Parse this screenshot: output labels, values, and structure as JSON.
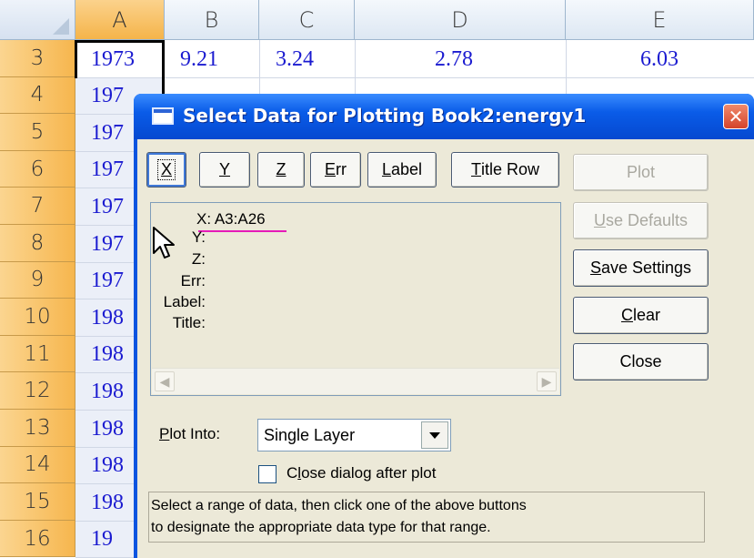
{
  "spreadsheet": {
    "columns": [
      "A",
      "B",
      "C",
      "D",
      "E"
    ],
    "rows": [
      "3",
      "4",
      "5",
      "6",
      "7",
      "8",
      "9",
      "10",
      "11",
      "12",
      "13",
      "14",
      "15",
      "16"
    ],
    "row3": [
      "1973",
      "9.21",
      "3.24",
      "2.78",
      "6.03"
    ],
    "colA_partial": [
      "197",
      "197",
      "197",
      "197",
      "197",
      "197",
      "198",
      "198",
      "198",
      "198",
      "198",
      "198",
      "19"
    ]
  },
  "dialog": {
    "title": "Select Data for Plotting  Book2:energy1",
    "close_glyph": "✕",
    "type_buttons": {
      "x": "X",
      "y": "Y",
      "z": "Z",
      "err_ul": "E",
      "err_rest": "rr",
      "label_ul": "L",
      "label_rest": "abel",
      "title_row_ul": "T",
      "title_row_rest": "itle Row"
    },
    "assignments": {
      "x_value": "X: A3:A26",
      "y_label": "Y:",
      "z_label": "Z:",
      "err_label": "Err:",
      "label_label": "Label:",
      "title_label": "Title:"
    },
    "side_buttons": {
      "plot": "Plot",
      "use_defaults_ul": "U",
      "use_defaults_rest": "se Defaults",
      "save_settings_ul": "S",
      "save_settings_rest": "ave Settings",
      "clear_ul": "C",
      "clear_rest": "lear",
      "close": "Close"
    },
    "plot_into": {
      "label_ul": "P",
      "label_rest": "lot Into:",
      "selected": "Single Layer"
    },
    "close_after_plot": {
      "label_pre": "C",
      "label_ul": "l",
      "label_rest": "ose dialog after plot",
      "checked": false
    },
    "info_lines": [
      "Select a range of data, then click one of the above buttons",
      "to designate the appropriate data type for that range."
    ]
  }
}
